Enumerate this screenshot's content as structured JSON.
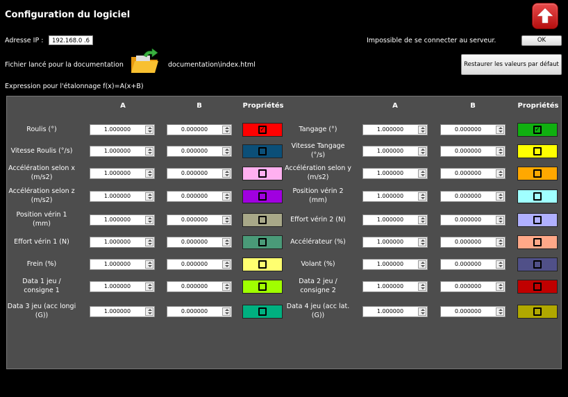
{
  "header": {
    "title": "Configuration du logiciel",
    "ip_label": "Adresse IP :",
    "ip_value": "192.168.0 .6",
    "status_text": "Impossible de se connecter au serveur.",
    "ok_label": "OK",
    "doc_label": "Fichier lancé pour la documentation",
    "doc_path": "documentation\\index.html",
    "restore_label": "Restaurer les valeurs par défaut",
    "formula_label": "Expression pour l'étalonnage f(x)=A(x+B)"
  },
  "table": {
    "col_a": "A",
    "col_b": "B",
    "col_props": "Propriétés",
    "left_rows": [
      {
        "label": "Roulis (°)",
        "a": "1.000000",
        "b": "0.000000",
        "color": "#ff0000",
        "checked": true
      },
      {
        "label": "Vitesse Roulis (°/s)",
        "a": "1.000000",
        "b": "0.000000",
        "color": "#0b4f78",
        "checked": false
      },
      {
        "label": "Accélération selon x (m/s2)",
        "a": "1.000000",
        "b": "0.000000",
        "color": "#ffb0f0",
        "checked": false
      },
      {
        "label": "Accélération selon z (m/s2)",
        "a": "1.000000",
        "b": "0.000000",
        "color": "#a000e0",
        "checked": false
      },
      {
        "label": "Position vérin 1 (mm)",
        "a": "1.000000",
        "b": "0.000000",
        "color": "#a8a888",
        "checked": false
      },
      {
        "label": "Effort vérin 1 (N)",
        "a": "1.000000",
        "b": "0.000000",
        "color": "#4a9a78",
        "checked": false
      },
      {
        "label": "Frein (%)",
        "a": "1.000000",
        "b": "0.000000",
        "color": "#ffff70",
        "checked": false
      },
      {
        "label": "Data 1 jeu / consigne 1",
        "a": "1.000000",
        "b": "0.000000",
        "color": "#a0ff00",
        "checked": false
      },
      {
        "label": "Data 3 jeu (acc longi (G))",
        "a": "1.000000",
        "b": "0.000000",
        "color": "#00b080",
        "checked": false
      }
    ],
    "right_rows": [
      {
        "label": "Tangage (°)",
        "a": "1.000000",
        "b": "0.000000",
        "color": "#10b010",
        "checked": true
      },
      {
        "label": "Vitesse Tangage (°/s)",
        "a": "1.000000",
        "b": "0.000000",
        "color": "#ffff00",
        "checked": false
      },
      {
        "label": "Accélération selon y (m/s2)",
        "a": "1.000000",
        "b": "0.000000",
        "color": "#ffa800",
        "checked": false
      },
      {
        "label": "Position vérin 2 (mm)",
        "a": "1.000000",
        "b": "0.000000",
        "color": "#a0ffff",
        "checked": false
      },
      {
        "label": "Effort vérin 2 (N)",
        "a": "1.000000",
        "b": "0.000000",
        "color": "#b0b0ff",
        "checked": false
      },
      {
        "label": "Accélérateur (%)",
        "a": "1.000000",
        "b": "0.000000",
        "color": "#ffa888",
        "checked": false
      },
      {
        "label": "Volant (%)",
        "a": "1.000000",
        "b": "0.000000",
        "color": "#505088",
        "checked": false
      },
      {
        "label": "Data 2 jeu / consigne 2",
        "a": "1.000000",
        "b": "0.000000",
        "color": "#c00000",
        "checked": false
      },
      {
        "label": "Data 4 jeu (acc lat. (G))",
        "a": "1.000000",
        "b": "0.000000",
        "color": "#b0a800",
        "checked": false
      }
    ]
  }
}
